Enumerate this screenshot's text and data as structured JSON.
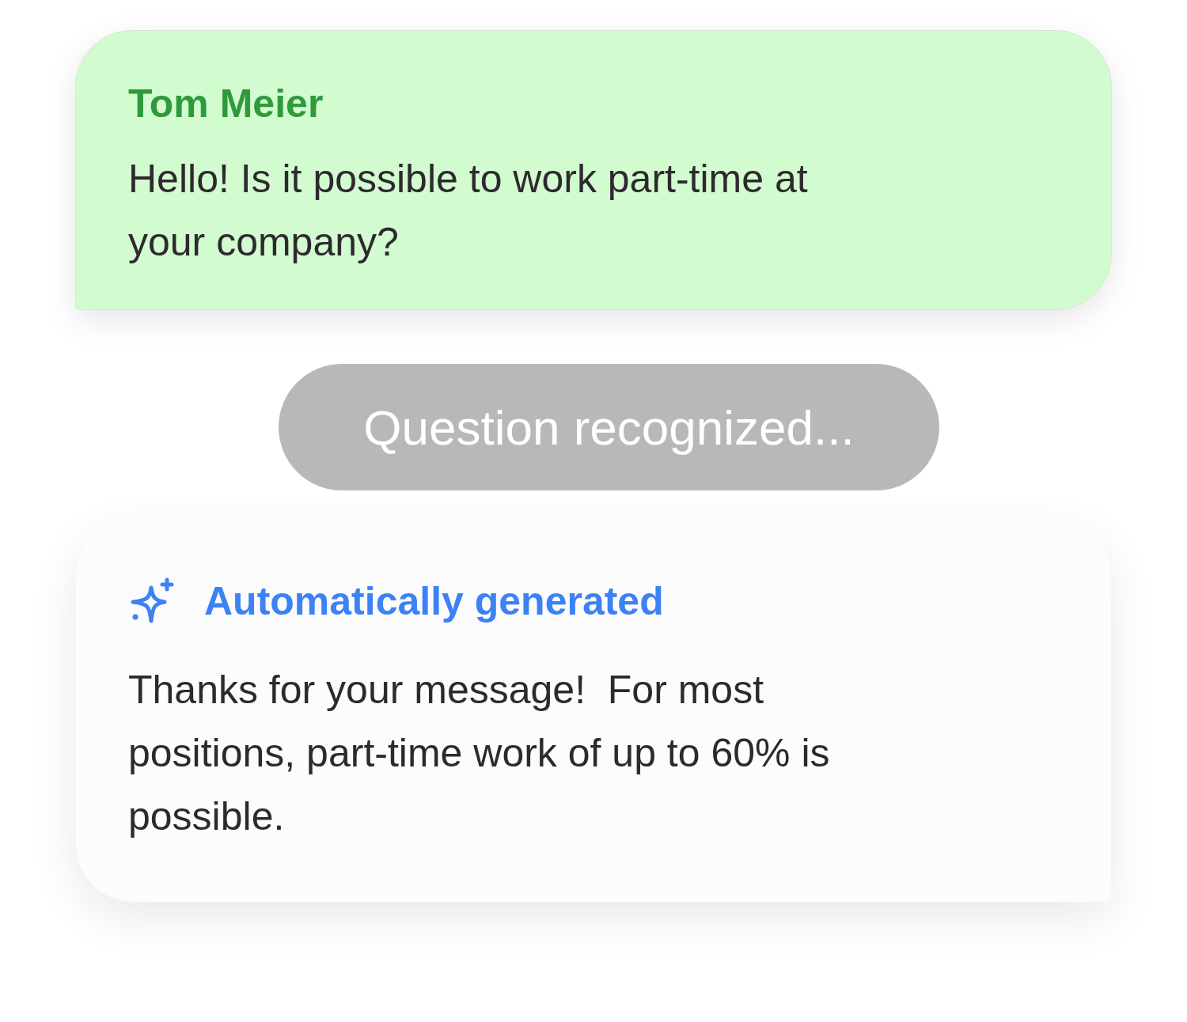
{
  "messages": [
    {
      "kind": "incoming",
      "sender": "Tom Meier",
      "text": "Hello! Is it possible to work part-time at your company?"
    },
    {
      "kind": "status",
      "text": "Question recognized..."
    },
    {
      "kind": "generated",
      "label": "Automatically generated",
      "text": "Thanks for your message!  For most positions, part-time work of up to 60% is possible."
    }
  ]
}
